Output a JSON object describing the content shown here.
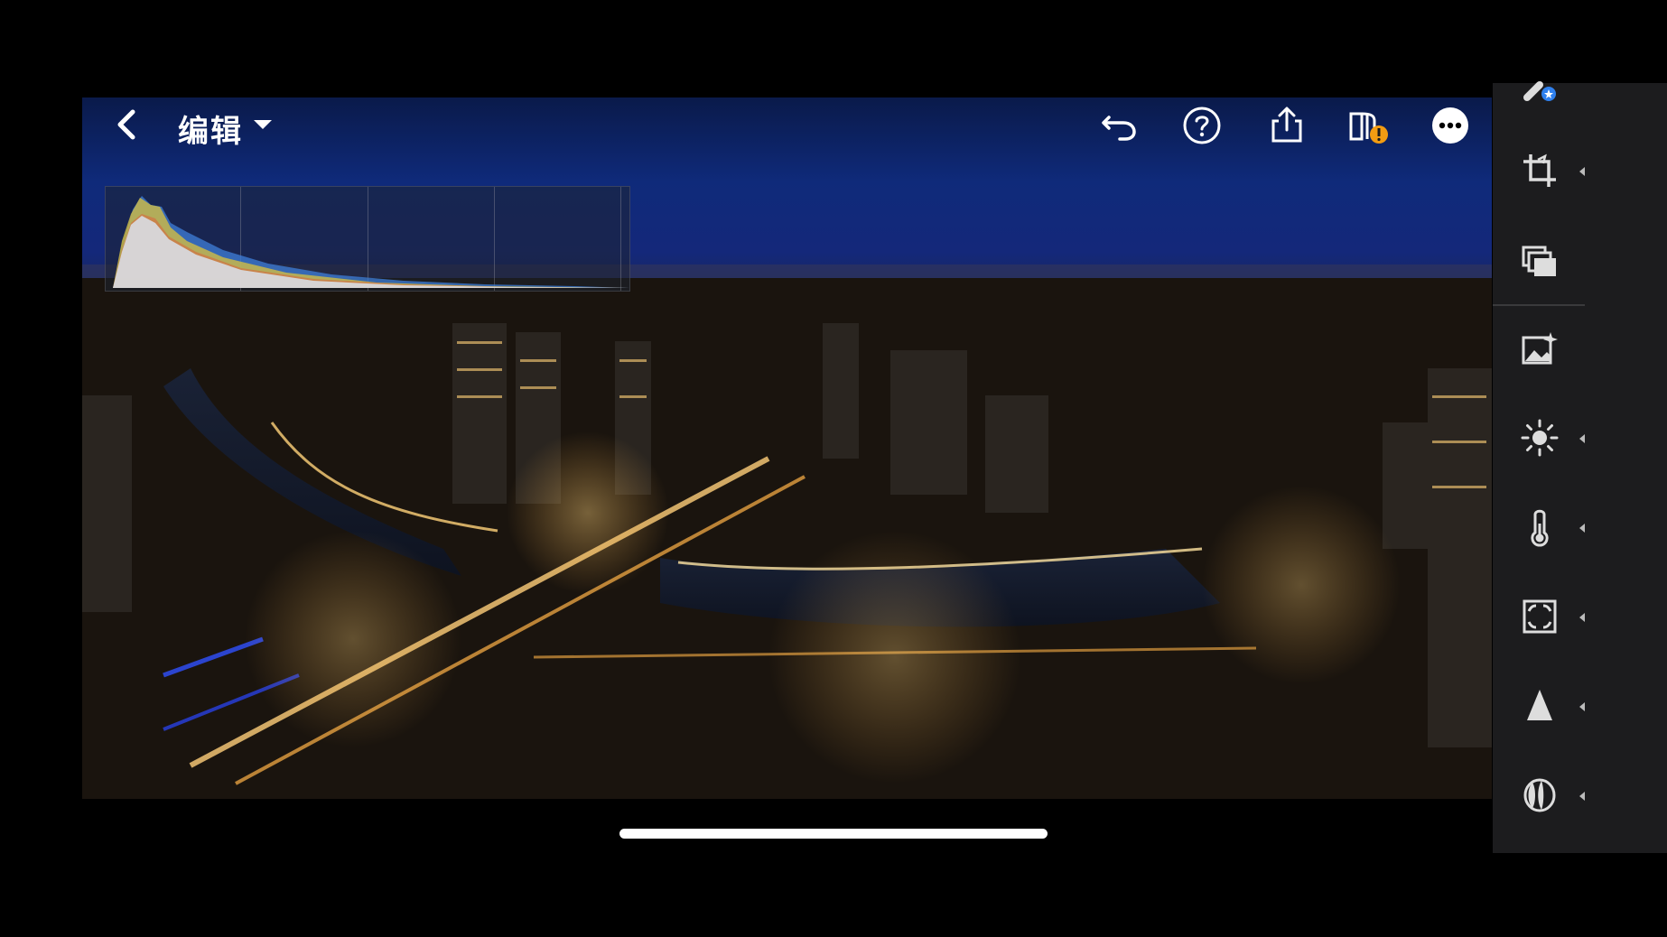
{
  "header": {
    "title": "编辑"
  },
  "toolbar": {
    "icons": [
      "undo-icon",
      "help-icon",
      "share-icon",
      "version-warning-icon",
      "more-icon"
    ]
  },
  "histogram": {
    "visible": true,
    "colors": {
      "red": "#e05a3a",
      "green": "#c9b84a",
      "blue": "#3f7fd9",
      "luminance": "#d8d8dc"
    }
  },
  "side_panel": {
    "tools": [
      "auto-icon",
      "crop-icon",
      "presets-icon",
      "enhance-icon",
      "light-icon",
      "color-icon",
      "effects-icon",
      "detail-icon",
      "optics-icon"
    ]
  },
  "colors": {
    "background": "#000000",
    "panel": "#1c1c1e",
    "accent_blue": "#2f80ed",
    "warning_orange": "#f39c12"
  }
}
